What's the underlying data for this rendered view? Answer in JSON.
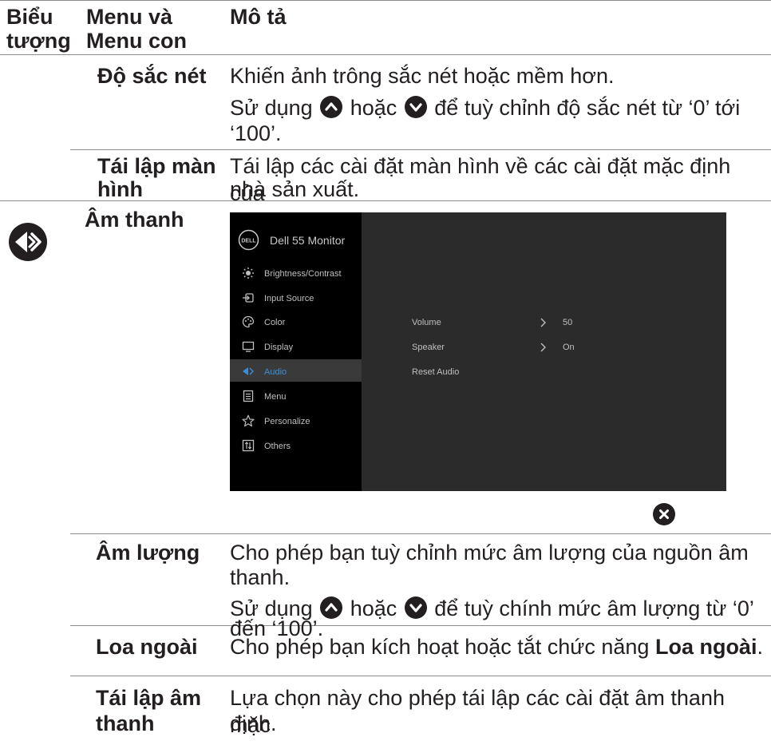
{
  "header": {
    "col1_line1": "Biểu",
    "col1_line2": "tượng",
    "col2_line1": "Menu và",
    "col2_line2": "Menu con",
    "col3": "Mô tả"
  },
  "rows": {
    "sharpness": {
      "name": "Độ sắc nét",
      "desc1": "Khiến ảnh trông sắc nét hoặc mềm hơn.",
      "desc2_a": "Sử dụng",
      "desc2_b": "hoặc",
      "desc2_c": "để tuỳ chỉnh độ sắc nét từ ‘0’ tới",
      "desc2_d": "‘100’."
    },
    "reset_display": {
      "name_line1": "Tái lập màn",
      "name_line2": "hình",
      "desc_line1": "Tái lập các cài đặt màn hình về các cài đặt mặc định của",
      "desc_line2": "nhà sản xuất."
    },
    "audio": {
      "name": "Âm thanh"
    },
    "volume": {
      "name": "Âm lượng",
      "desc_line1": "Cho phép bạn tuỳ chỉnh mức âm lượng của nguồn âm",
      "desc_line2": "thanh.",
      "desc2_a": "Sử dụng",
      "desc2_b": "hoặc",
      "desc2_c": "để tuỳ chính mức âm lượng từ ‘0’",
      "desc2_d": "đến ‘100’."
    },
    "speaker": {
      "name": "Loa ngoài",
      "desc_a": "Cho phép bạn kích hoạt hoặc tắt chức năng ",
      "desc_b": "Loa ngoài",
      "desc_c": "."
    },
    "reset_audio": {
      "name_line1": "Tái lập âm",
      "name_line2": "thanh",
      "desc_line1": "Lựa chọn này cho phép tái lập các cài đặt âm thanh mặc",
      "desc_line2": "định."
    }
  },
  "osd": {
    "logo": "DELL",
    "title": "Dell 55 Monitor",
    "menu": [
      {
        "label": "Brightness/Contrast",
        "icon": "sun-icon"
      },
      {
        "label": "Input Source",
        "icon": "input-icon"
      },
      {
        "label": "Color",
        "icon": "palette-icon"
      },
      {
        "label": "Display",
        "icon": "monitor-icon"
      },
      {
        "label": "Audio",
        "icon": "speaker-icon",
        "selected": true
      },
      {
        "label": "Menu",
        "icon": "list-icon"
      },
      {
        "label": "Personalize",
        "icon": "star-icon"
      },
      {
        "label": "Others",
        "icon": "others-icon"
      }
    ],
    "settings": [
      {
        "label": "Volume",
        "value": "50"
      },
      {
        "label": "Speaker",
        "value": "On"
      },
      {
        "label": "Reset Audio",
        "value": ""
      }
    ]
  },
  "colors": {
    "text": "#231f20",
    "rule": "#8c8c8c",
    "osd_bg": "#2b2b2b",
    "osd_sidebar": "#000000",
    "osd_accent": "#3a8fd8"
  }
}
